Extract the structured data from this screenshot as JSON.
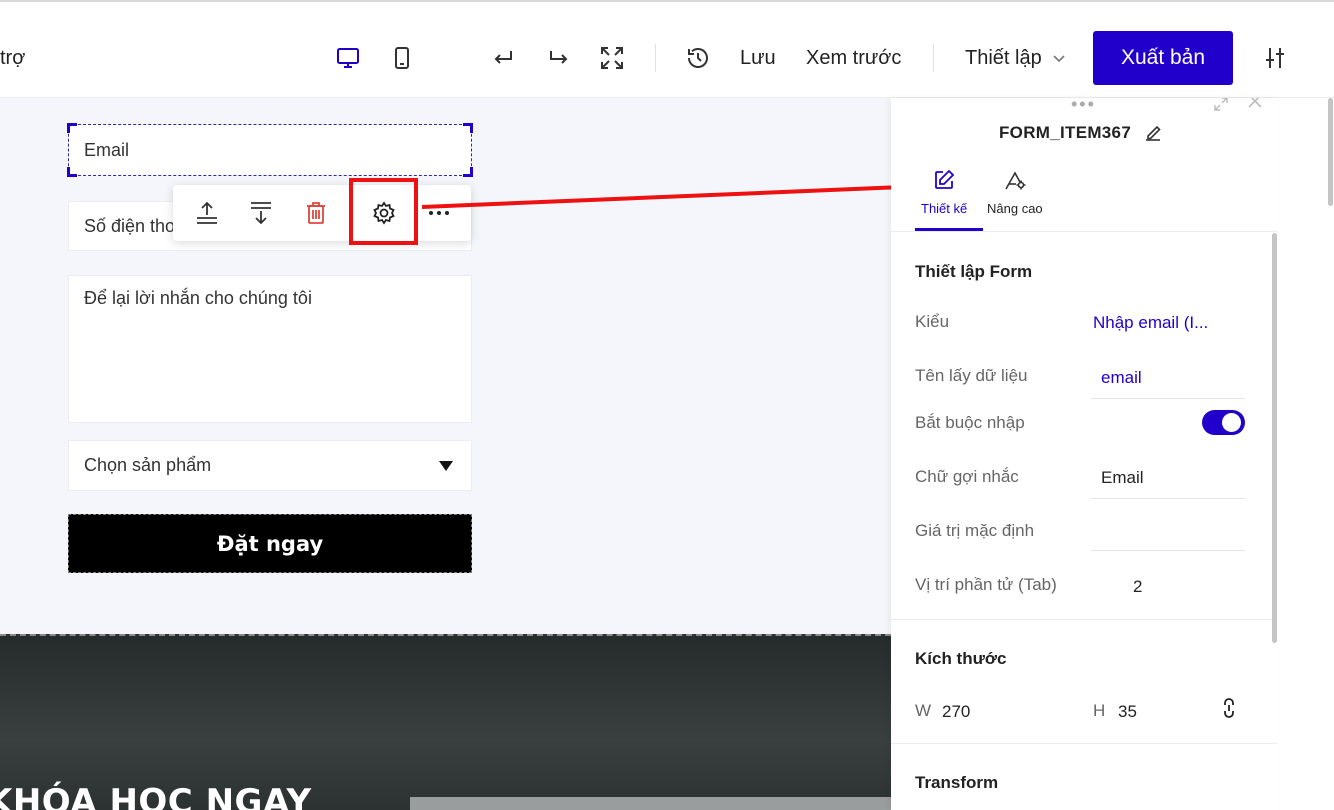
{
  "topbar": {
    "support_label": "trợ",
    "save_label": "Lưu",
    "preview_label": "Xem trước",
    "settings_label": "Thiết lập",
    "publish_label": "Xuất bản"
  },
  "form": {
    "email_placeholder": "Email",
    "phone_placeholder": "Số điện tho",
    "message_placeholder": "Để lại lời nhắn cho chúng tôi",
    "product_select": "Chọn sản phẩm",
    "submit_label": "Đặt ngay"
  },
  "section": {
    "heading": "KHÓA HỌC NGAY"
  },
  "panel": {
    "title": "FORM_ITEM367",
    "tabs": [
      {
        "label": "Thiết kế",
        "active": true
      },
      {
        "label": "Nâng cao",
        "active": false
      }
    ],
    "form_settings": {
      "title": "Thiết lập Form",
      "type_label": "Kiểu",
      "type_value": "Nhập email (I...",
      "data_name_label": "Tên lấy dữ liệu",
      "data_name_value": "email",
      "required_label": "Bắt buộc nhập",
      "required_value": true,
      "hint_label": "Chữ gợi nhắc",
      "hint_value": "Email",
      "default_label": "Giá trị mặc định",
      "default_value": "",
      "tab_index_label": "Vị trí phần tử (Tab)",
      "tab_index_value": "2"
    },
    "size": {
      "title": "Kích thước",
      "w_label": "W",
      "w_value": "270",
      "h_label": "H",
      "h_value": "35"
    },
    "transform": {
      "title": "Transform"
    }
  },
  "colors": {
    "accent": "#2200cc",
    "highlight": "#ee1111",
    "delete": "#e0453a"
  },
  "icons": [
    "desktop-icon",
    "mobile-icon",
    "undo-icon",
    "redo-icon",
    "fullscreen-icon",
    "history-icon",
    "chevron-down-icon",
    "sliders-icon",
    "move-up-icon",
    "move-down-icon",
    "trash-icon",
    "gear-icon",
    "more-icon",
    "dropdown-arrow-icon",
    "edit-pen-icon",
    "design-tab-icon",
    "advanced-tab-icon",
    "collapse-icon",
    "close-icon",
    "link-ratio-icon"
  ]
}
